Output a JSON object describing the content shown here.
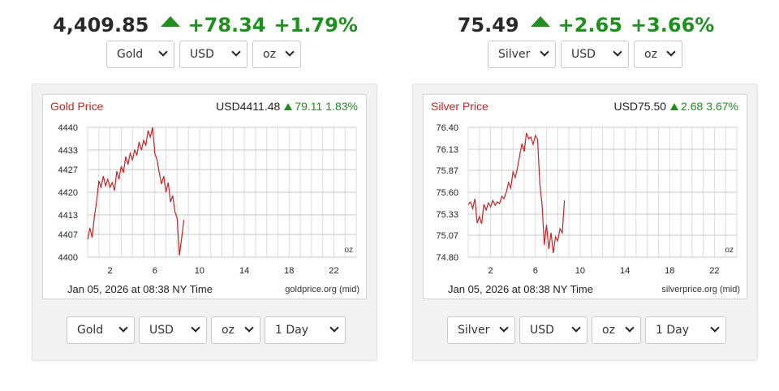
{
  "widgets": [
    {
      "ticker": {
        "price": "4,409.85",
        "change": "+78.34",
        "percent": "+1.79%"
      },
      "top_selects": {
        "metal": "Gold",
        "currency": "USD",
        "unit": "oz"
      },
      "chart": {
        "title": "Gold Price",
        "price": "USD4411.48",
        "change": "79.11",
        "percent": "1.83%",
        "footer": "Jan 05, 2026 at 08:38 NY Time",
        "source": "goldprice.org (mid)",
        "unit_label": "oz"
      },
      "bottom_selects": {
        "metal": "Gold",
        "currency": "USD",
        "unit": "oz",
        "range": "1 Day"
      }
    },
    {
      "ticker": {
        "price": "75.49",
        "change": "+2.65",
        "percent": "+3.66%"
      },
      "top_selects": {
        "metal": "Silver",
        "currency": "USD",
        "unit": "oz"
      },
      "chart": {
        "title": "Silver Price",
        "price": "USD75.50",
        "change": "2.68",
        "percent": "3.67%",
        "footer": "Jan 05, 2026 at 08:38 NY Time",
        "source": "silverprice.org (mid)",
        "unit_label": "oz"
      },
      "bottom_selects": {
        "metal": "Silver",
        "currency": "USD",
        "unit": "oz",
        "range": "1 Day"
      }
    }
  ],
  "chart_data": [
    {
      "type": "line",
      "title": "Gold Price",
      "xlabel": "",
      "ylabel": "",
      "x_ticks": [
        2,
        6,
        10,
        14,
        18,
        22
      ],
      "y_ticks": [
        4400,
        4407,
        4413,
        4420,
        4427,
        4433,
        4440
      ],
      "xlim": [
        0,
        24
      ],
      "ylim": [
        4400,
        4440
      ],
      "grid": true,
      "line_color": "#cc2222",
      "series": [
        {
          "x": [
            0.0,
            0.2,
            0.4,
            0.6,
            0.8,
            1.0,
            1.2,
            1.4,
            1.6,
            1.8,
            2.0,
            2.2,
            2.4,
            2.6,
            2.8,
            3.0,
            3.2,
            3.4,
            3.6,
            3.8,
            4.0,
            4.2,
            4.4,
            4.6,
            4.8,
            5.0,
            5.2,
            5.4,
            5.6,
            5.8,
            6.0,
            6.2,
            6.4,
            6.6,
            6.8,
            7.0,
            7.2,
            7.4,
            7.6,
            7.8,
            8.0,
            8.2,
            8.4,
            8.6
          ],
          "y": [
            4405.5,
            4409.0,
            4406.0,
            4412.5,
            4417.0,
            4423.5,
            4421.5,
            4425.0,
            4422.0,
            4424.0,
            4421.5,
            4423.0,
            4420.5,
            4426.5,
            4424.0,
            4428.0,
            4426.0,
            4431.0,
            4428.5,
            4432.0,
            4430.0,
            4433.0,
            4431.5,
            4435.5,
            4433.0,
            4436.0,
            4434.5,
            4439.0,
            4437.0,
            4440.0,
            4432.0,
            4430.0,
            4426.0,
            4422.5,
            4425.0,
            4420.0,
            4423.0,
            4417.0,
            4419.0,
            4414.0,
            4412.0,
            4400.5,
            4406.0,
            4411.5
          ]
        }
      ]
    },
    {
      "type": "line",
      "title": "Silver Price",
      "xlabel": "",
      "ylabel": "",
      "x_ticks": [
        2,
        6,
        10,
        14,
        18,
        22
      ],
      "y_ticks": [
        74.8,
        75.07,
        75.33,
        75.6,
        75.87,
        76.13,
        76.4
      ],
      "xlim": [
        0,
        24
      ],
      "ylim": [
        74.8,
        76.4
      ],
      "grid": true,
      "line_color": "#cc2222",
      "series": [
        {
          "x": [
            0.0,
            0.2,
            0.4,
            0.6,
            0.8,
            1.0,
            1.2,
            1.4,
            1.6,
            1.8,
            2.0,
            2.2,
            2.4,
            2.6,
            2.8,
            3.0,
            3.2,
            3.4,
            3.6,
            3.8,
            4.0,
            4.2,
            4.4,
            4.6,
            4.8,
            5.0,
            5.2,
            5.4,
            5.6,
            5.8,
            6.0,
            6.2,
            6.4,
            6.6,
            6.8,
            7.0,
            7.2,
            7.4,
            7.6,
            7.8,
            8.0,
            8.2,
            8.4,
            8.6
          ],
          "y": [
            75.45,
            75.48,
            75.4,
            75.52,
            75.22,
            75.3,
            75.21,
            75.45,
            75.38,
            75.47,
            75.42,
            75.5,
            75.44,
            75.48,
            75.46,
            75.55,
            75.52,
            75.6,
            75.72,
            75.65,
            75.85,
            75.78,
            75.9,
            76.05,
            76.2,
            76.1,
            76.33,
            76.26,
            76.28,
            76.19,
            76.3,
            76.25,
            75.7,
            75.45,
            74.95,
            75.2,
            74.9,
            75.1,
            74.85,
            75.05,
            75.0,
            75.15,
            75.1,
            75.5
          ]
        }
      ]
    }
  ]
}
